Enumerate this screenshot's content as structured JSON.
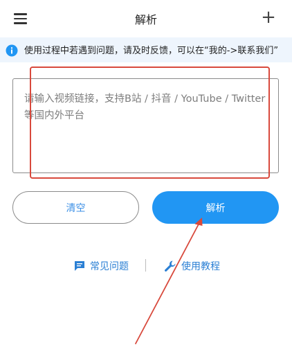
{
  "header": {
    "menu_icon": "hamburger-menu-icon",
    "title": "解析",
    "add_icon": "plus-icon"
  },
  "notice": {
    "icon": "info-icon",
    "text": "使用过程中若遇到问题，请及时反馈，可以在“我的->联系我们”"
  },
  "input": {
    "placeholder": "请输入视频链接，支持B站 / 抖音 / YouTube / Twitter等国内外平台",
    "value": ""
  },
  "buttons": {
    "clear_label": "清空",
    "parse_label": "解析"
  },
  "links": {
    "faq_label": "常见问题",
    "faq_icon": "chat-bubble-icon",
    "tutorial_label": "使用教程",
    "tutorial_icon": "wrench-icon"
  },
  "colors": {
    "accent": "#2196f3",
    "link": "#2a7fd4",
    "notice_bg": "#eef5fd",
    "annotation": "#d8493c"
  }
}
